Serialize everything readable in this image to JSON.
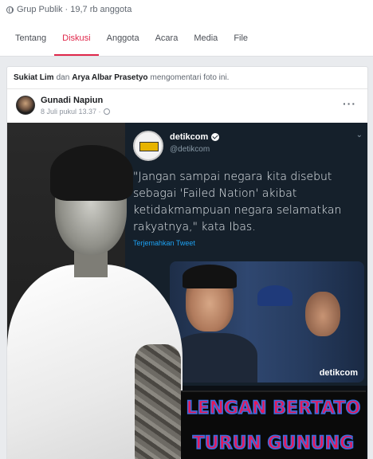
{
  "group": {
    "privacy_text": "Grup Publik · 19,7 rb anggota"
  },
  "tabs": [
    {
      "label": "Tentang",
      "active": false
    },
    {
      "label": "Diskusi",
      "active": true
    },
    {
      "label": "Anggota",
      "active": false
    },
    {
      "label": "Acara",
      "active": false
    },
    {
      "label": "Media",
      "active": false
    },
    {
      "label": "File",
      "active": false
    }
  ],
  "activity": {
    "user1": "Sukiat Lim",
    "conjunction": "dan",
    "user2": "Arya Albar Prasetyo",
    "action": "mengomentari foto ini."
  },
  "post": {
    "author": "Gunadi Napiun",
    "timestamp": "8 Juli pukul 13.37 ·",
    "more_label": "···"
  },
  "tweet": {
    "name": "detikcom",
    "handle": "@detikcom",
    "text": "\"Jangan sampai negara kita disebut sebagai 'Failed Nation' akibat ketidakmampuan negara selamatkan rakyatnya,\" kata Ibas.",
    "translate": "Terjemahkan Tweet",
    "watermark": "detikcom"
  },
  "banner": {
    "line1": "LENGAN BERTATO",
    "line2": "TURUN GUNUNG"
  },
  "colors": {
    "accent": "#e0284b",
    "page_bg": "#e9ebee",
    "tweet_bg": "#15202b",
    "banner_text": "#e5195a"
  }
}
